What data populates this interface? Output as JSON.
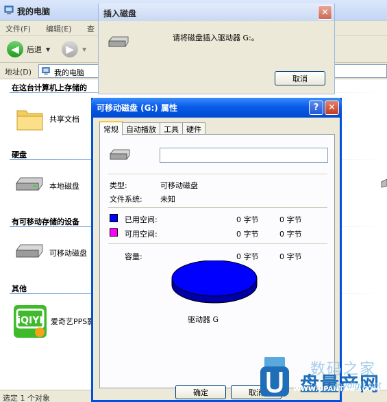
{
  "explorer": {
    "title": "我的电脑",
    "menu": [
      "文件(F)",
      "编辑(E)",
      "查"
    ],
    "back_label": "后退",
    "address_label": "地址(D)",
    "address_value": "我的电脑",
    "groups": [
      {
        "header": "在这台计算机上存储的",
        "items": [
          {
            "label": "共享文档",
            "icon": "folder-icon"
          }
        ]
      },
      {
        "header": "硬盘",
        "items": [
          {
            "label": "本地磁盘",
            "icon": "hard-disk-icon"
          }
        ]
      },
      {
        "header": "有可移动存储的设备",
        "items": [
          {
            "label": "可移动磁盘",
            "icon": "removable-disk-icon"
          }
        ]
      },
      {
        "header": "其他",
        "items": [
          {
            "label": "爱奇艺PPS影",
            "icon": "iqiyi-icon"
          }
        ]
      }
    ],
    "status": "选定 1 个对象"
  },
  "insert_dialog": {
    "title": "插入磁盘",
    "message": "请将磁盘插入驱动器 G:。",
    "cancel_label": "取消"
  },
  "properties_dialog": {
    "title": "可移动磁盘 (G:) 属性",
    "tabs": [
      "常规",
      "自动播放",
      "工具",
      "硬件"
    ],
    "selected_tab": "常规",
    "name_value": "",
    "type_label": "类型:",
    "type_value": "可移动磁盘",
    "fs_label": "文件系统:",
    "fs_value": "未知",
    "used_label": "已用空间:",
    "used_bytes": "0 字节",
    "used_size": "0 字节",
    "free_label": "可用空间:",
    "free_bytes": "0 字节",
    "free_size": "0 字节",
    "capacity_label": "容量:",
    "capacity_bytes": "0 字节",
    "capacity_size": "0 字节",
    "drive_caption": "驱动器 G",
    "ok_label": "确定",
    "cancel_label": "取消",
    "used_color": "#0000ff",
    "free_color": "#ff00ff"
  },
  "watermark": {
    "line1": "数码之家",
    "line2": "盘量产网",
    "url": "WWW.UPANTOOL.COM",
    "url2": "mydigit.net"
  }
}
